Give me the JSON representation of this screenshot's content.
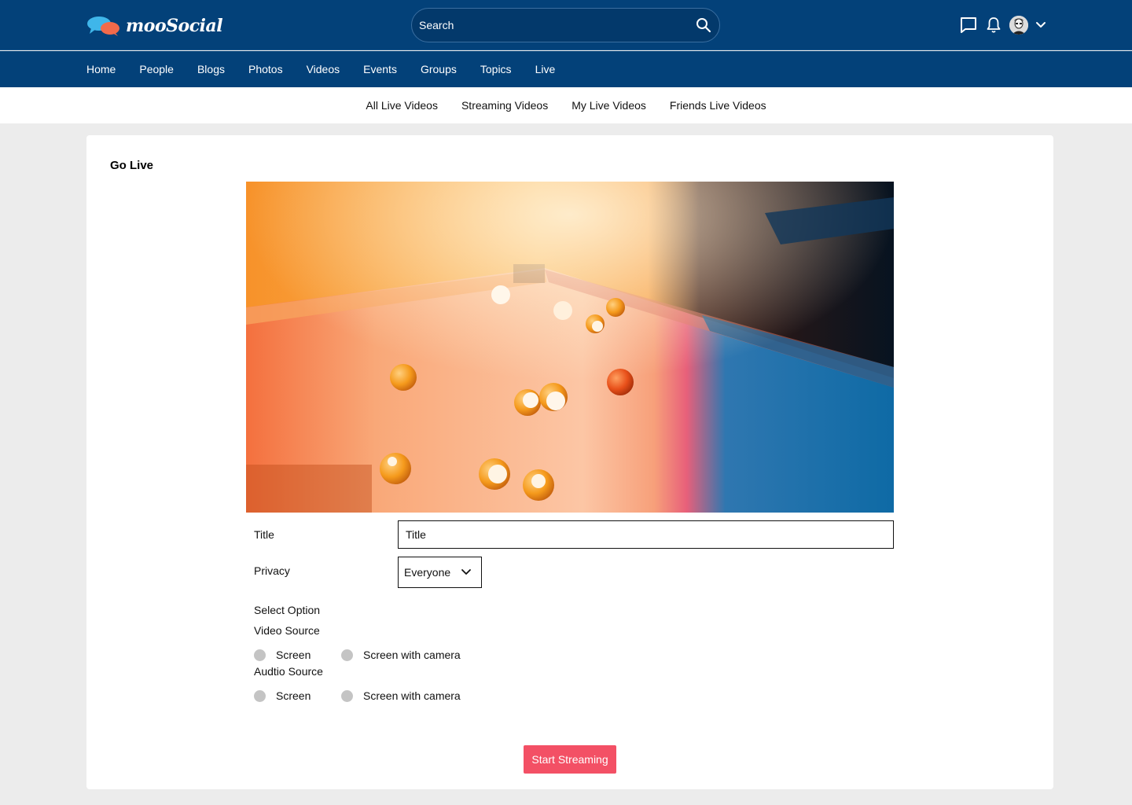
{
  "app": {
    "brand": "mooSocial"
  },
  "search": {
    "placeholder": "Search"
  },
  "header_icons": [
    "message-icon",
    "bell-icon",
    "avatar",
    "chevron-down-icon"
  ],
  "main_nav": [
    "Home",
    "People",
    "Blogs",
    "Photos",
    "Videos",
    "Events",
    "Groups",
    "Topics",
    "Live"
  ],
  "sub_nav": [
    "All Live Videos",
    "Streaming Videos",
    "My Live Videos",
    "Friends Live Videos"
  ],
  "page": {
    "title": "Go Live"
  },
  "form": {
    "title_label": "Title",
    "title_placeholder": "Title",
    "privacy_label": "Privacy",
    "privacy_value": "Everyone",
    "select_option_label": "Select Option",
    "video_source_label": "Video Source",
    "video_options": [
      "Screen",
      "Screen with camera"
    ],
    "audio_source_label": "Audtio Source",
    "audio_options": [
      "Screen",
      "Screen with camera"
    ],
    "start_button": "Start Streaming"
  },
  "colors": {
    "header_bg": "#034179",
    "accent_button": "#f35065",
    "radio_fill": "#c4c4c4",
    "page_bg": "#ececec"
  }
}
